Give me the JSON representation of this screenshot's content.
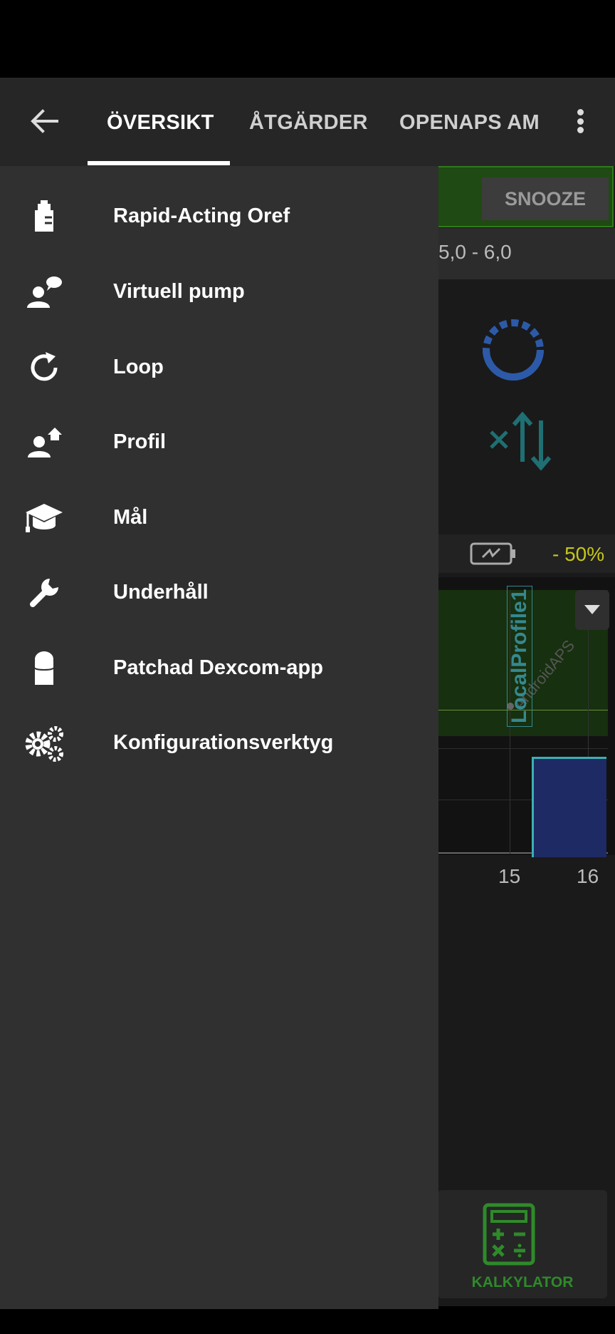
{
  "header": {
    "tabs": [
      {
        "label": "ÖVERSIKT",
        "active": true
      },
      {
        "label": "ÅTGÄRDER",
        "active": false
      },
      {
        "label": "OPENAPS AM",
        "active": false
      }
    ]
  },
  "overview": {
    "snooze_label": "SNOOZE",
    "target_range": "5,0 - 6,0",
    "battery_percent": "- 50%",
    "graph": {
      "profile_label": "LocalProfile1",
      "watermark": "AndroidAPS",
      "x_ticks": [
        "15",
        "16"
      ]
    },
    "calculator_label": "KALKYLATOR"
  },
  "drawer": {
    "items": [
      {
        "label": "Rapid-Acting Oref",
        "icon": "insulin-icon"
      },
      {
        "label": "Virtuell pump",
        "icon": "pump-icon"
      },
      {
        "label": "Loop",
        "icon": "loop-icon"
      },
      {
        "label": "Profil",
        "icon": "profile-icon"
      },
      {
        "label": "Mål",
        "icon": "graduation-cap-icon"
      },
      {
        "label": "Underhåll",
        "icon": "wrench-icon"
      },
      {
        "label": "Patchad Dexcom-app",
        "icon": "sensor-icon"
      },
      {
        "label": "Konfigurationsverktyg",
        "icon": "gears-icon"
      }
    ]
  },
  "colors": {
    "accent_green": "#2f7a1b",
    "battery_yellow": "#c5c71a",
    "profile_teal": "#36888f",
    "drawer_bg": "#303030"
  }
}
